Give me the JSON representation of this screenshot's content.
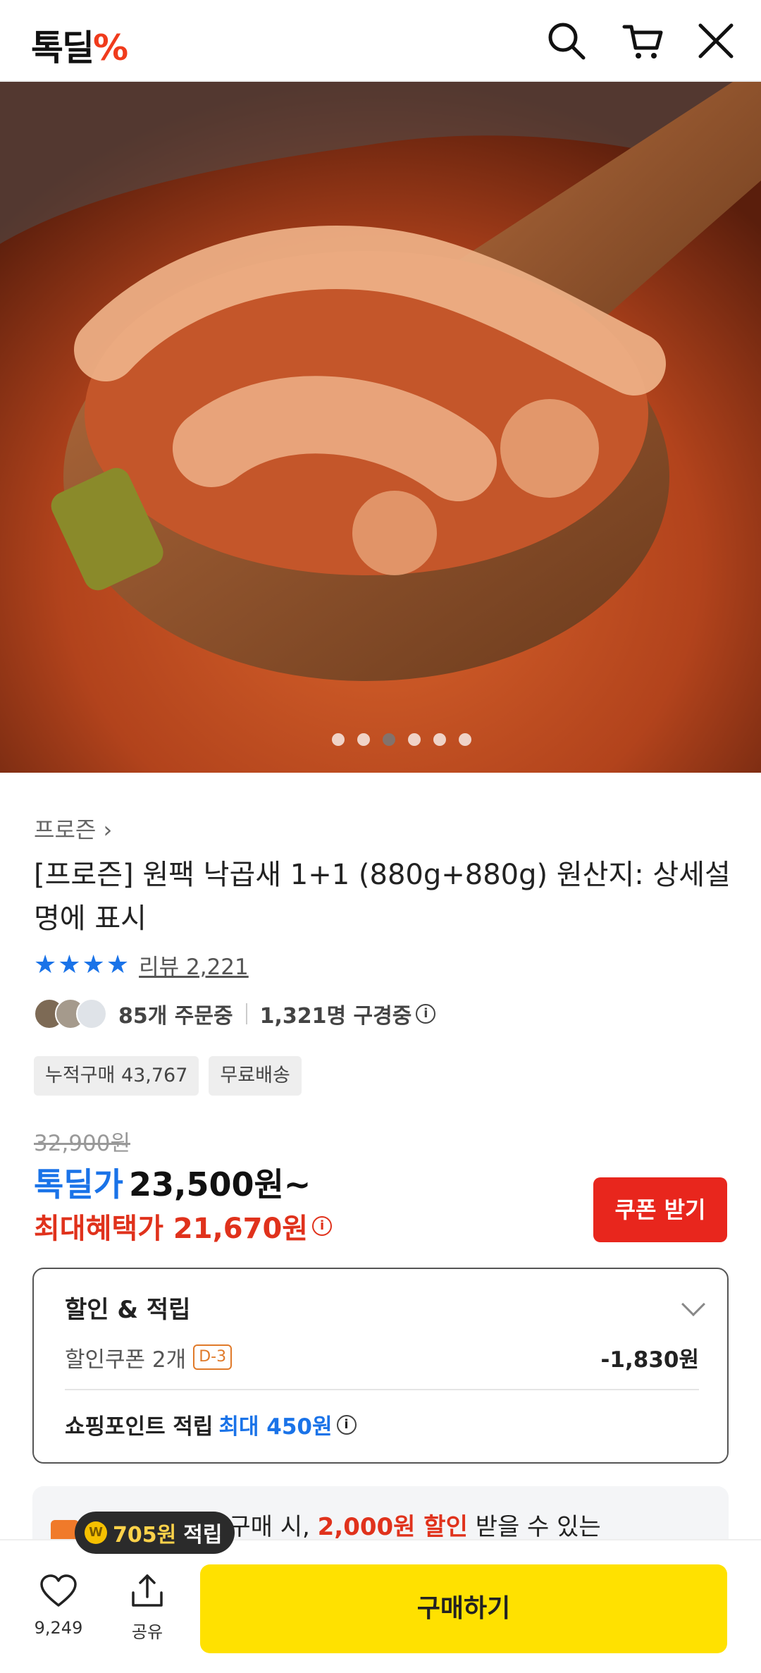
{
  "header": {
    "logo_text": "톡딜",
    "logo_accent": "%",
    "icons": [
      "search-icon",
      "cart-icon",
      "close-icon"
    ]
  },
  "hero": {
    "image_count": 6,
    "active_index": 2
  },
  "product": {
    "category": "프로즌 ›",
    "title": "[프로즌] 원팩 낙곱새 1+1 (880g+880g) 원산지: 상세설명에 표시",
    "stars": "★★★★",
    "review_label": "리뷰 2,221",
    "orders_text": "85개 주문중",
    "viewers_text": "1,321명 구경중",
    "chips": [
      "누적구매 43,767",
      "무료배송"
    ]
  },
  "pricing": {
    "original_price": "32,900원",
    "deal_label": "톡딜가",
    "deal_price": "23,500원~",
    "max_benefit": "최대혜택가 21,670원",
    "coupon_button": "쿠폰 받기"
  },
  "discount": {
    "heading": "할인 & 적립",
    "coupon_label": "할인쿠폰 2개",
    "coupon_tag": "D-3",
    "coupon_value": "-1,830원",
    "point_label": "쇼핑포인트 적립",
    "point_value": "최대 450원"
  },
  "promo": {
    "text_pre": "0만원 이상 구매 시,",
    "text_red": "2,000원 할인",
    "text_post": "받을 수 있는"
  },
  "tooltip": {
    "points": "705원",
    "label": "적립"
  },
  "bottom_bar": {
    "like_count": "9,249",
    "share_label": "공유",
    "buy_label": "구매하기"
  },
  "colors": {
    "accent_blue": "#1a73e8",
    "accent_red": "#e0321c",
    "buy_yellow": "#ffe100"
  }
}
